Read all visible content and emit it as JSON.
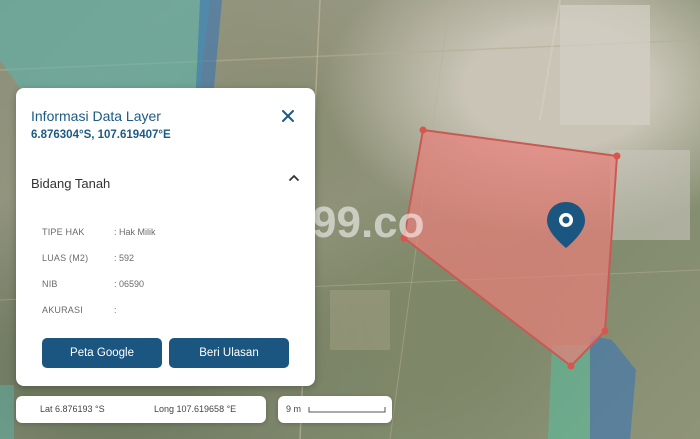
{
  "panel": {
    "title": "Informasi Data Layer",
    "coordinates": "6.876304°S, 107.619407°E",
    "section_title": "Bidang Tanah",
    "fields": [
      {
        "label": "TIPE HAK",
        "value": ": Hak Milik"
      },
      {
        "label": "LUAS (M2)",
        "value": ": 592"
      },
      {
        "label": "NIB",
        "value": ": 06590"
      },
      {
        "label": "AKURASI",
        "value": ":"
      }
    ],
    "buttons": {
      "google_map": "Peta Google",
      "review": "Beri Ulasan"
    }
  },
  "map": {
    "watermark": "99.co",
    "parcel_color": "#e8807a",
    "marker_color": "#1b5680",
    "footer": {
      "lat": "Lat 6.876193 °S",
      "long": "Long 107.619658 °E",
      "scale": "9 m"
    }
  },
  "icons": [
    "close-icon",
    "chevron-up-icon",
    "location-pin-icon"
  ],
  "colors": {
    "accent": "#1b5680",
    "title": "#1c5a84"
  }
}
